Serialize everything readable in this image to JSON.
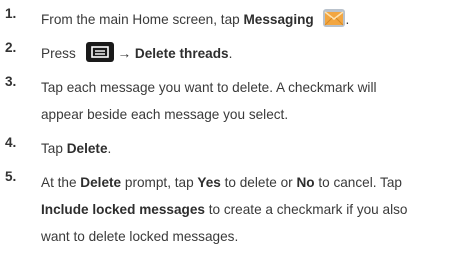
{
  "steps": [
    {
      "number": "1.",
      "prefix": "From the main Home screen, tap ",
      "bold": "Messaging",
      "suffix": "."
    },
    {
      "number": "2.",
      "prefix": "Press",
      "arrow": "→",
      "bold": "Delete threads",
      "suffix": "."
    },
    {
      "number": "3.",
      "line1": "Tap each message you want to delete. A checkmark will",
      "line2": "appear beside each message you select."
    },
    {
      "number": "4.",
      "prefix": "Tap ",
      "bold": "Delete",
      "suffix": "."
    },
    {
      "number": "5.",
      "l1_a": "At the ",
      "l1_bold1": "Delete",
      "l1_b": " prompt, tap ",
      "l1_bold2": "Yes",
      "l1_c": " to delete or ",
      "l1_bold3": "No",
      "l1_d": " to cancel. Tap",
      "l2_bold": "Include locked messages",
      "l2_a": " to create a checkmark if you also",
      "line3": "want to delete locked messages."
    }
  ],
  "icons": {
    "messaging": "messaging-icon",
    "menu_key": "menu-key-icon"
  },
  "colors": {
    "text": "#3a3a3a",
    "menu_key": "#1a1a1a",
    "messaging_icon": "#f2a641"
  }
}
